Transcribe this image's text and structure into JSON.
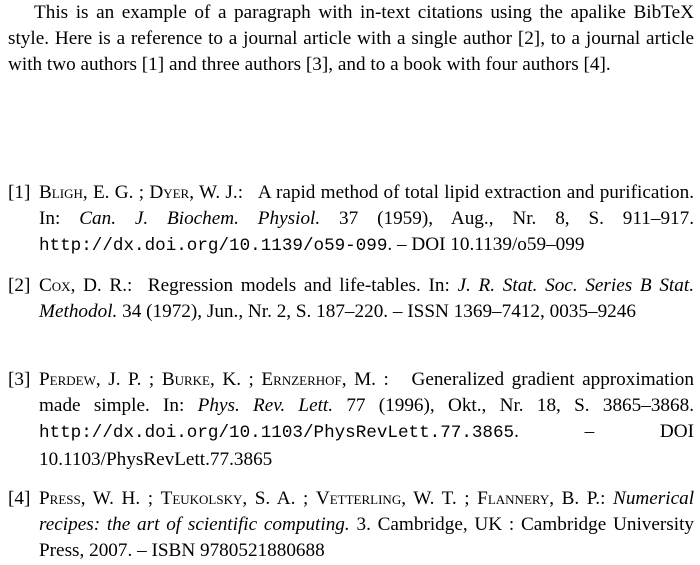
{
  "paragraph": {
    "text_before_2": "This is an example of a paragraph with in-text citations using the apalike BibTeX style. Here is a reference to a journal article with a single author ",
    "cite_2": "[2]",
    "text_before_1": ", to a journal article with two authors ",
    "cite_1": "[1]",
    "text_before_3": " and three authors ",
    "cite_3": "[3]",
    "text_before_4": ", and to a book with four authors ",
    "cite_4": "[4]",
    "text_end": "."
  },
  "references": [
    {
      "label": "[1]",
      "authors": [
        {
          "last": "Bligh",
          "first": "E. G."
        },
        {
          "last": "Dyer",
          "first": "W. J."
        }
      ],
      "title": "A rapid method of total lipid extraction and purification.",
      "in": "In:",
      "journal": "Can. J. Biochem. Physiol.",
      "details": "37 (1959), Aug., Nr. 8, S. 911–917.",
      "url": "http://dx.doi.org/10.1139/o59-099",
      "tail": ". – DOI 10.1139/o59–099"
    },
    {
      "label": "[2]",
      "authors": [
        {
          "last": "Cox",
          "first": "D. R."
        }
      ],
      "title": "Regression models and life-tables.",
      "in": "In:",
      "journal": "J. R. Stat. Soc. Series B Stat. Methodol.",
      "details": "34 (1972), Jun., Nr. 2, S. 187–220. – ISSN 1369–7412, 0035–9246"
    },
    {
      "label": "[3]",
      "authors": [
        {
          "last": "Perdew",
          "first": "J. P."
        },
        {
          "last": "Burke",
          "first": "K."
        },
        {
          "last": "Ernzerhof",
          "first": "M."
        }
      ],
      "title": "Generalized gradient approximation made simple.",
      "in": "In:",
      "journal": "Phys. Rev. Lett.",
      "details": "77 (1996), Okt., Nr. 18, S. 3865–3868.",
      "url": "http://dx.doi.org/10.1103/PhysRevLett.77.3865",
      "tail": ". – DOI 10.1103/PhysRevLett.77.3865"
    },
    {
      "label": "[4]",
      "authors": [
        {
          "last": "Press",
          "first": "W. H."
        },
        {
          "last": "Teukolsky",
          "first": "S. A."
        },
        {
          "last": "Vetterling",
          "first": "W. T."
        },
        {
          "last": "Flannery",
          "first": "B. P."
        }
      ],
      "title": "Numerical recipes: the art of scientific computing.",
      "details": "3. Cambridge, UK : Cambridge University Press, 2007. – ISBN 9780521880688"
    }
  ]
}
